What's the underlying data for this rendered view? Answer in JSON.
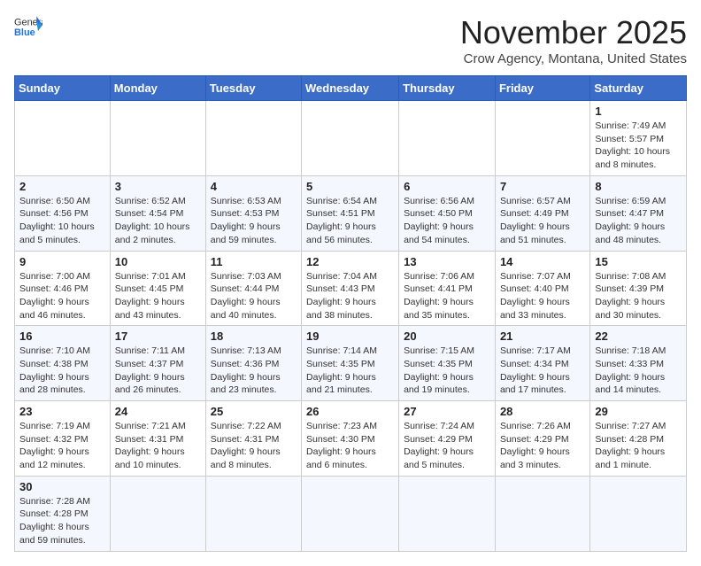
{
  "logo": {
    "general": "General",
    "blue": "Blue"
  },
  "title": "November 2025",
  "subtitle": "Crow Agency, Montana, United States",
  "weekdays": [
    "Sunday",
    "Monday",
    "Tuesday",
    "Wednesday",
    "Thursday",
    "Friday",
    "Saturday"
  ],
  "weeks": [
    [
      null,
      null,
      null,
      null,
      null,
      null,
      {
        "day": "1",
        "sunrise": "Sunrise: 7:49 AM",
        "sunset": "Sunset: 5:57 PM",
        "daylight": "Daylight: 10 hours and 8 minutes."
      }
    ],
    [
      {
        "day": "2",
        "sunrise": "Sunrise: 6:50 AM",
        "sunset": "Sunset: 4:56 PM",
        "daylight": "Daylight: 10 hours and 5 minutes."
      },
      {
        "day": "3",
        "sunrise": "Sunrise: 6:52 AM",
        "sunset": "Sunset: 4:54 PM",
        "daylight": "Daylight: 10 hours and 2 minutes."
      },
      {
        "day": "4",
        "sunrise": "Sunrise: 6:53 AM",
        "sunset": "Sunset: 4:53 PM",
        "daylight": "Daylight: 9 hours and 59 minutes."
      },
      {
        "day": "5",
        "sunrise": "Sunrise: 6:54 AM",
        "sunset": "Sunset: 4:51 PM",
        "daylight": "Daylight: 9 hours and 56 minutes."
      },
      {
        "day": "6",
        "sunrise": "Sunrise: 6:56 AM",
        "sunset": "Sunset: 4:50 PM",
        "daylight": "Daylight: 9 hours and 54 minutes."
      },
      {
        "day": "7",
        "sunrise": "Sunrise: 6:57 AM",
        "sunset": "Sunset: 4:49 PM",
        "daylight": "Daylight: 9 hours and 51 minutes."
      },
      {
        "day": "8",
        "sunrise": "Sunrise: 6:59 AM",
        "sunset": "Sunset: 4:47 PM",
        "daylight": "Daylight: 9 hours and 48 minutes."
      }
    ],
    [
      {
        "day": "9",
        "sunrise": "Sunrise: 7:00 AM",
        "sunset": "Sunset: 4:46 PM",
        "daylight": "Daylight: 9 hours and 46 minutes."
      },
      {
        "day": "10",
        "sunrise": "Sunrise: 7:01 AM",
        "sunset": "Sunset: 4:45 PM",
        "daylight": "Daylight: 9 hours and 43 minutes."
      },
      {
        "day": "11",
        "sunrise": "Sunrise: 7:03 AM",
        "sunset": "Sunset: 4:44 PM",
        "daylight": "Daylight: 9 hours and 40 minutes."
      },
      {
        "day": "12",
        "sunrise": "Sunrise: 7:04 AM",
        "sunset": "Sunset: 4:43 PM",
        "daylight": "Daylight: 9 hours and 38 minutes."
      },
      {
        "day": "13",
        "sunrise": "Sunrise: 7:06 AM",
        "sunset": "Sunset: 4:41 PM",
        "daylight": "Daylight: 9 hours and 35 minutes."
      },
      {
        "day": "14",
        "sunrise": "Sunrise: 7:07 AM",
        "sunset": "Sunset: 4:40 PM",
        "daylight": "Daylight: 9 hours and 33 minutes."
      },
      {
        "day": "15",
        "sunrise": "Sunrise: 7:08 AM",
        "sunset": "Sunset: 4:39 PM",
        "daylight": "Daylight: 9 hours and 30 minutes."
      }
    ],
    [
      {
        "day": "16",
        "sunrise": "Sunrise: 7:10 AM",
        "sunset": "Sunset: 4:38 PM",
        "daylight": "Daylight: 9 hours and 28 minutes."
      },
      {
        "day": "17",
        "sunrise": "Sunrise: 7:11 AM",
        "sunset": "Sunset: 4:37 PM",
        "daylight": "Daylight: 9 hours and 26 minutes."
      },
      {
        "day": "18",
        "sunrise": "Sunrise: 7:13 AM",
        "sunset": "Sunset: 4:36 PM",
        "daylight": "Daylight: 9 hours and 23 minutes."
      },
      {
        "day": "19",
        "sunrise": "Sunrise: 7:14 AM",
        "sunset": "Sunset: 4:35 PM",
        "daylight": "Daylight: 9 hours and 21 minutes."
      },
      {
        "day": "20",
        "sunrise": "Sunrise: 7:15 AM",
        "sunset": "Sunset: 4:35 PM",
        "daylight": "Daylight: 9 hours and 19 minutes."
      },
      {
        "day": "21",
        "sunrise": "Sunrise: 7:17 AM",
        "sunset": "Sunset: 4:34 PM",
        "daylight": "Daylight: 9 hours and 17 minutes."
      },
      {
        "day": "22",
        "sunrise": "Sunrise: 7:18 AM",
        "sunset": "Sunset: 4:33 PM",
        "daylight": "Daylight: 9 hours and 14 minutes."
      }
    ],
    [
      {
        "day": "23",
        "sunrise": "Sunrise: 7:19 AM",
        "sunset": "Sunset: 4:32 PM",
        "daylight": "Daylight: 9 hours and 12 minutes."
      },
      {
        "day": "24",
        "sunrise": "Sunrise: 7:21 AM",
        "sunset": "Sunset: 4:31 PM",
        "daylight": "Daylight: 9 hours and 10 minutes."
      },
      {
        "day": "25",
        "sunrise": "Sunrise: 7:22 AM",
        "sunset": "Sunset: 4:31 PM",
        "daylight": "Daylight: 9 hours and 8 minutes."
      },
      {
        "day": "26",
        "sunrise": "Sunrise: 7:23 AM",
        "sunset": "Sunset: 4:30 PM",
        "daylight": "Daylight: 9 hours and 6 minutes."
      },
      {
        "day": "27",
        "sunrise": "Sunrise: 7:24 AM",
        "sunset": "Sunset: 4:29 PM",
        "daylight": "Daylight: 9 hours and 5 minutes."
      },
      {
        "day": "28",
        "sunrise": "Sunrise: 7:26 AM",
        "sunset": "Sunset: 4:29 PM",
        "daylight": "Daylight: 9 hours and 3 minutes."
      },
      {
        "day": "29",
        "sunrise": "Sunrise: 7:27 AM",
        "sunset": "Sunset: 4:28 PM",
        "daylight": "Daylight: 9 hours and 1 minute."
      }
    ],
    [
      {
        "day": "30",
        "sunrise": "Sunrise: 7:28 AM",
        "sunset": "Sunset: 4:28 PM",
        "daylight": "Daylight: 8 hours and 59 minutes."
      },
      null,
      null,
      null,
      null,
      null,
      null
    ]
  ]
}
